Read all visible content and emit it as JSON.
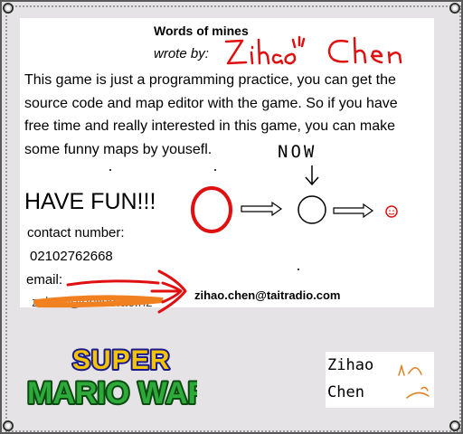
{
  "title": "Words of mines",
  "wrote_by": "wrote by:",
  "author_handwritten": "Zihao Chen",
  "body": "This game is just a programming practice, you can get the source code and map editor with the game. So if you have free time and really interested in this game, you can make some funny maps by yousefl.",
  "have_fun": "HAVE FUN!!!",
  "now_label": "NOW",
  "contact": {
    "label": "contact number:",
    "number": "02102762668",
    "email_label": "email:",
    "email_struck": "zch21@uclive.ac.nz",
    "email": "zihao.chen@taitradio.com"
  },
  "logo": {
    "line1": "SUPER",
    "line2": "MARIO WAR"
  },
  "signature": {
    "line1": "Zihao",
    "line2": "Chen"
  },
  "colors": {
    "frame": "#e6e3e7",
    "paper": "#ffffff",
    "red_ink": "#e01010",
    "orange_scribble": "#f08020"
  }
}
